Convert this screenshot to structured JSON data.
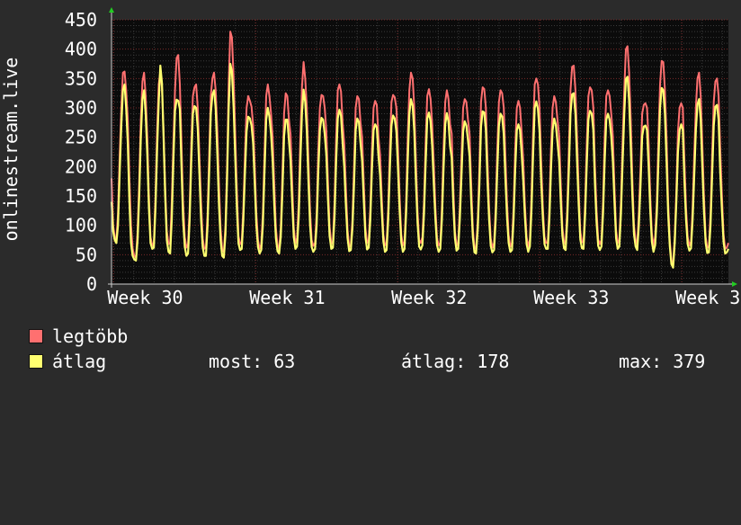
{
  "chart_data": {
    "type": "line",
    "ylabel": "onlinestream.live",
    "ylim": [
      0,
      450
    ],
    "yticks": [
      0,
      50,
      100,
      150,
      200,
      250,
      300,
      350,
      400,
      450
    ],
    "xticks": [
      {
        "label": "Week 30",
        "value": 0
      },
      {
        "label": "Week 31",
        "value": 7
      },
      {
        "label": "Week 32",
        "value": 14
      },
      {
        "label": "Week 33",
        "value": 21
      },
      {
        "label": "Week 3",
        "value": 28
      }
    ],
    "xlim": [
      -0.1,
      30.3
    ],
    "grid": true,
    "series": [
      {
        "name": "legtöbb",
        "color": "#ff7070",
        "width": 2,
        "values": [
          180,
          100,
          80,
          75,
          120,
          220,
          300,
          360,
          362,
          330,
          280,
          180,
          100,
          60,
          48,
          45,
          90,
          175,
          280,
          345,
          360,
          320,
          250,
          150,
          80,
          65,
          70,
          150,
          260,
          340,
          362,
          335,
          260,
          165,
          90,
          68,
          70,
          140,
          240,
          330,
          385,
          390,
          340,
          240,
          140,
          80,
          62,
          68,
          130,
          240,
          320,
          335,
          340,
          300,
          220,
          140,
          78,
          60,
          62,
          120,
          220,
          320,
          350,
          360,
          330,
          260,
          170,
          95,
          58,
          55,
          100,
          200,
          340,
          430,
          420,
          350,
          255,
          160,
          82,
          68,
          72,
          130,
          220,
          300,
          320,
          312,
          302,
          270,
          200,
          120,
          75,
          60,
          68,
          120,
          220,
          320,
          340,
          320,
          290,
          250,
          170,
          95,
          66,
          60,
          95,
          190,
          290,
          325,
          320,
          280,
          255,
          175,
          95,
          70,
          78,
          140,
          250,
          335,
          378,
          350,
          300,
          210,
          125,
          75,
          65,
          70,
          120,
          225,
          300,
          322,
          320,
          300,
          260,
          175,
          98,
          69,
          72,
          140,
          250,
          330,
          340,
          328,
          275,
          240,
          165,
          92,
          64,
          66,
          110,
          200,
          300,
          320,
          315,
          275,
          250,
          170,
          95,
          70,
          75,
          130,
          230,
          300,
          312,
          305,
          252,
          220,
          150,
          85,
          66,
          70,
          130,
          230,
          310,
          322,
          318,
          300,
          230,
          150,
          85,
          66,
          72,
          140,
          250,
          330,
          360,
          350,
          300,
          210,
          125,
          75,
          70,
          80,
          140,
          240,
          320,
          332,
          315,
          272,
          205,
          130,
          78,
          66,
          70,
          130,
          230,
          310,
          330,
          315,
          272,
          256,
          165,
          90,
          66,
          70,
          130,
          220,
          300,
          315,
          310,
          280,
          255,
          170,
          94,
          62,
          60,
          110,
          200,
          310,
          335,
          332,
          300,
          210,
          130,
          78,
          62,
          70,
          130,
          230,
          310,
          330,
          325,
          300,
          218,
          140,
          84,
          64,
          70,
          130,
          230,
          300,
          312,
          300,
          258,
          210,
          135,
          80,
          64,
          75,
          150,
          260,
          340,
          350,
          340,
          300,
          210,
          130,
          80,
          70,
          70,
          130,
          230,
          300,
          320,
          310,
          280,
          252,
          170,
          96,
          72,
          68,
          130,
          230,
          330,
          370,
          372,
          330,
          250,
          160,
          90,
          72,
          70,
          140,
          240,
          320,
          335,
          330,
          300,
          200,
          125,
          76,
          68,
          75,
          140,
          250,
          320,
          330,
          320,
          290,
          252,
          165,
          92,
          70,
          75,
          140,
          240,
          330,
          400,
          405,
          360,
          280,
          180,
          100,
          75,
          68,
          120,
          200,
          290,
          305,
          308,
          300,
          240,
          150,
          86,
          65,
          80,
          140,
          250,
          340,
          380,
          378,
          330,
          250,
          140,
          75,
          40,
          35,
          80,
          160,
          260,
          300,
          308,
          300,
          210,
          130,
          80,
          66,
          72,
          130,
          220,
          300,
          350,
          360,
          320,
          240,
          150,
          80,
          62,
          64,
          120,
          220,
          310,
          345,
          350,
          320,
          230,
          150,
          85,
          60,
          62,
          70
        ]
      },
      {
        "name": "átlag",
        "color": "#ffff70",
        "width": 2.2,
        "values": [
          140,
          90,
          75,
          70,
          100,
          190,
          270,
          330,
          340,
          300,
          240,
          140,
          70,
          48,
          42,
          40,
          75,
          150,
          250,
          315,
          330,
          290,
          220,
          130,
          70,
          60,
          62,
          130,
          230,
          310,
          372,
          342,
          250,
          150,
          75,
          55,
          52,
          110,
          210,
          295,
          314,
          312,
          298,
          200,
          110,
          63,
          48,
          52,
          110,
          210,
          290,
          303,
          300,
          265,
          190,
          110,
          63,
          48,
          48,
          100,
          190,
          290,
          322,
          330,
          300,
          220,
          135,
          75,
          48,
          45,
          85,
          180,
          300,
          375,
          362,
          300,
          215,
          130,
          69,
          58,
          60,
          110,
          190,
          260,
          285,
          282,
          270,
          240,
          170,
          100,
          63,
          52,
          58,
          100,
          190,
          280,
          300,
          285,
          256,
          210,
          135,
          78,
          56,
          52,
          80,
          160,
          252,
          280,
          280,
          245,
          210,
          140,
          80,
          60,
          64,
          115,
          210,
          292,
          331,
          310,
          260,
          175,
          100,
          63,
          55,
          60,
          100,
          190,
          262,
          283,
          280,
          255,
          220,
          145,
          82,
          60,
          62,
          115,
          210,
          282,
          297,
          287,
          240,
          200,
          135,
          78,
          56,
          58,
          95,
          170,
          262,
          282,
          276,
          240,
          210,
          140,
          80,
          59,
          62,
          110,
          195,
          262,
          272,
          267,
          220,
          185,
          125,
          73,
          55,
          58,
          110,
          195,
          270,
          287,
          282,
          260,
          195,
          125,
          72,
          55,
          60,
          120,
          210,
          290,
          315,
          303,
          260,
          175,
          105,
          64,
          59,
          66,
          120,
          205,
          282,
          292,
          277,
          235,
          170,
          110,
          66,
          55,
          60,
          110,
          195,
          272,
          291,
          277,
          235,
          215,
          135,
          78,
          57,
          60,
          110,
          185,
          260,
          277,
          270,
          245,
          218,
          140,
          80,
          54,
          52,
          95,
          170,
          268,
          294,
          292,
          262,
          175,
          110,
          65,
          54,
          58,
          110,
          195,
          270,
          290,
          285,
          255,
          180,
          115,
          70,
          55,
          58,
          110,
          195,
          262,
          272,
          262,
          222,
          175,
          115,
          68,
          55,
          64,
          125,
          220,
          300,
          311,
          298,
          260,
          175,
          110,
          68,
          60,
          60,
          110,
          195,
          262,
          282,
          271,
          242,
          210,
          140,
          82,
          61,
          58,
          110,
          195,
          290,
          323,
          325,
          290,
          210,
          135,
          76,
          61,
          60,
          120,
          205,
          280,
          295,
          290,
          262,
          170,
          105,
          65,
          58,
          64,
          120,
          210,
          280,
          290,
          280,
          252,
          210,
          140,
          78,
          60,
          64,
          120,
          205,
          290,
          349,
          353,
          312,
          235,
          150,
          85,
          64,
          58,
          100,
          170,
          252,
          268,
          270,
          262,
          200,
          125,
          72,
          55,
          66,
          120,
          210,
          300,
          334,
          330,
          290,
          210,
          120,
          65,
          34,
          28,
          70,
          140,
          225,
          262,
          272,
          262,
          175,
          110,
          68,
          57,
          61,
          110,
          185,
          262,
          306,
          315,
          280,
          200,
          125,
          70,
          53,
          54,
          100,
          185,
          270,
          302,
          305,
          280,
          190,
          125,
          72,
          52,
          54,
          60
        ]
      }
    ]
  },
  "legend": {
    "items": [
      {
        "label": "legtöbb",
        "color": "#ff7070"
      },
      {
        "label": "átlag",
        "color": "#ffff70"
      }
    ],
    "stats": {
      "now": "most: 63",
      "avg": "átlag: 178",
      "max": "max: 379"
    }
  }
}
